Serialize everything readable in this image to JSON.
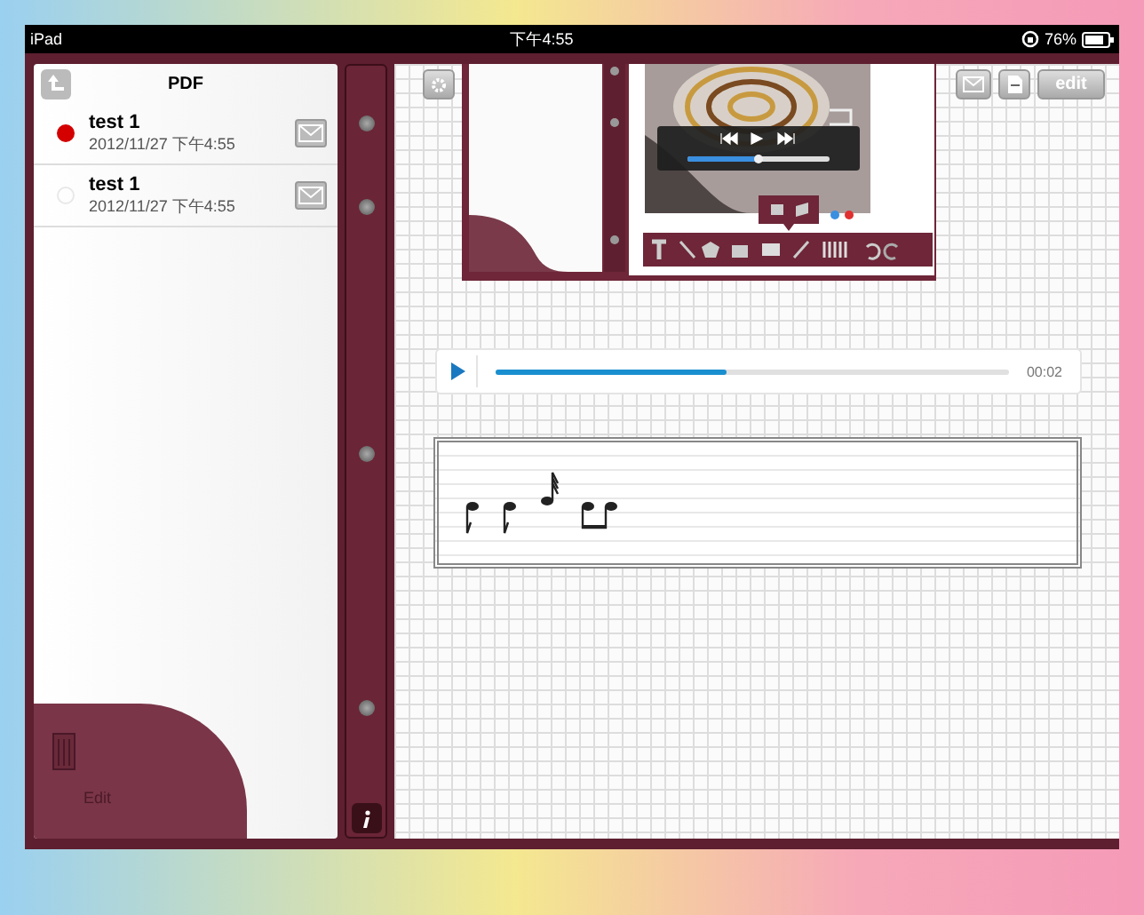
{
  "status_bar": {
    "device": "iPad",
    "time": "下午4:55",
    "battery": "76%"
  },
  "documents": {
    "title": "PDF",
    "items": [
      {
        "name": "test 1",
        "date": "2012/11/27 下午4:55",
        "selected": true
      },
      {
        "name": "test 1",
        "date": "2012/11/27 下午4:55",
        "selected": false
      }
    ],
    "edit_label": "Edit"
  },
  "toolbar": {
    "edit_button": "edit"
  },
  "audio_player": {
    "level": 0.45,
    "time": "00:02"
  }
}
